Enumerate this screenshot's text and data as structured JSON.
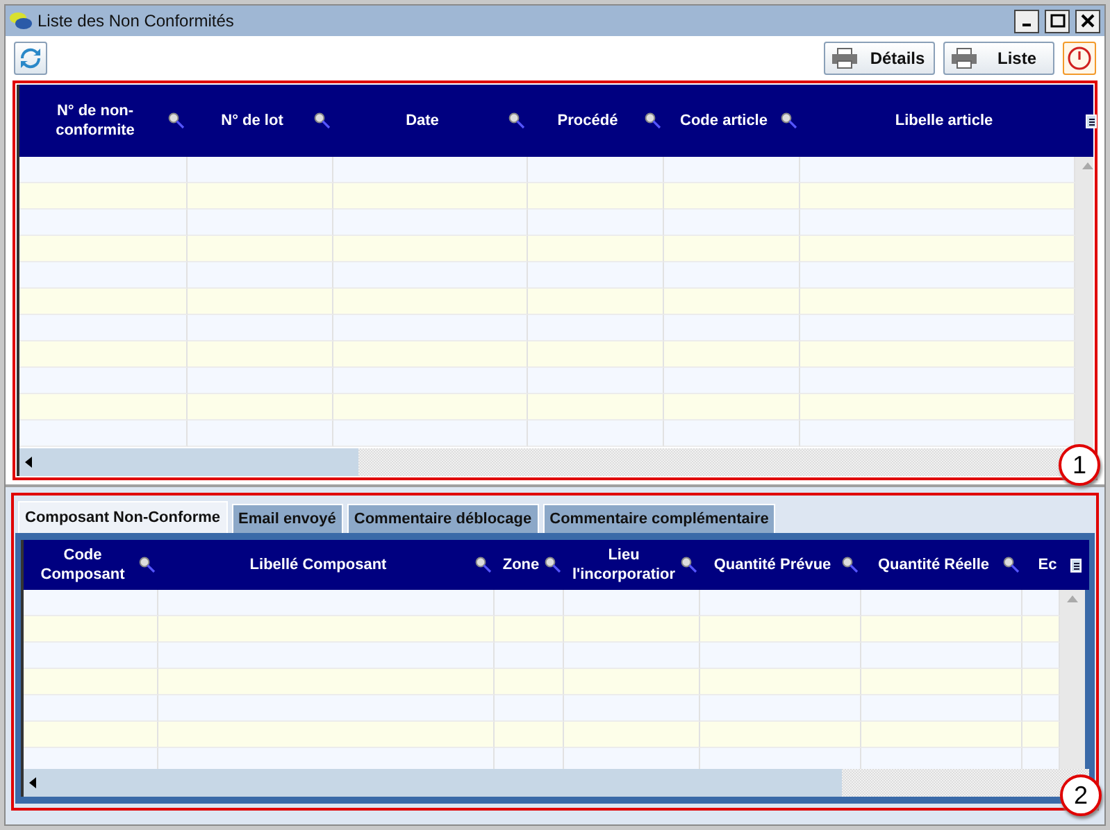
{
  "window": {
    "title": "Liste des Non Conformités"
  },
  "toolbar": {
    "buttons": [
      {
        "label": "Détails"
      },
      {
        "label": "Liste"
      }
    ]
  },
  "main_table": {
    "badge": "1",
    "columns": [
      {
        "label": "N° de non-conformite",
        "searchable": true
      },
      {
        "label": "N° de lot",
        "searchable": true
      },
      {
        "label": "Date",
        "searchable": true
      },
      {
        "label": "Procédé",
        "searchable": true
      },
      {
        "label": "Code article",
        "searchable": true
      },
      {
        "label": "Libelle article",
        "searchable": false
      }
    ]
  },
  "detail": {
    "badge": "2",
    "tabs": [
      {
        "label": "Composant Non-Conforme",
        "selected": true
      },
      {
        "label": "Email envoyé",
        "selected": false
      },
      {
        "label": "Commentaire déblocage",
        "selected": false
      },
      {
        "label": "Commentaire complémentaire",
        "selected": false
      }
    ],
    "columns": [
      {
        "label": "Code Composant",
        "searchable": true
      },
      {
        "label": "Libellé Composant",
        "searchable": true
      },
      {
        "label": "Zone",
        "searchable": true
      },
      {
        "label": "Lieu l'incorporatior",
        "searchable": true
      },
      {
        "label": "Quantité Prévue",
        "searchable": true
      },
      {
        "label": "Quantité Réelle",
        "searchable": true
      },
      {
        "label": "Ec",
        "searchable": false
      }
    ]
  }
}
